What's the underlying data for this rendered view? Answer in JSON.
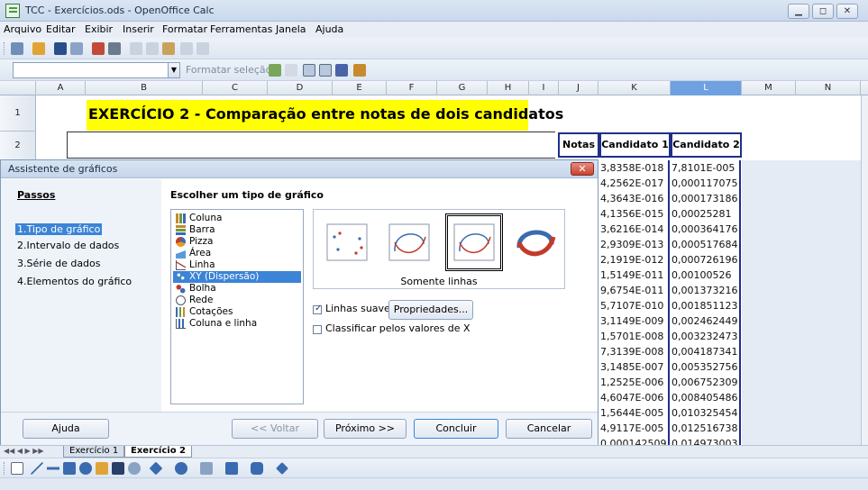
{
  "window": {
    "title": "TCC - Exercícios.ods - OpenOffice Calc",
    "controls": [
      "▁",
      "◻",
      "✕"
    ]
  },
  "menubar": [
    "Arquivo",
    "Editar",
    "Exibir",
    "Inserir",
    "Formatar",
    "Ferramentas",
    "Janela",
    "Ajuda"
  ],
  "formatbar": {
    "format_selection": "Formatar seleção"
  },
  "columns": [
    "A",
    "B",
    "C",
    "D",
    "E",
    "F",
    "G",
    "H",
    "I",
    "J",
    "K",
    "L",
    "M",
    "N"
  ],
  "rows": [
    "1",
    "2"
  ],
  "sheet": {
    "title": "EXERCÍCIO 2 - Comparação entre notas de dois candidatos",
    "headers": {
      "notas": "Notas",
      "cand1": "Candidato 1",
      "cand2": "Candidato 2"
    },
    "data": [
      [
        "3,8358E-018",
        "7,8101E-005"
      ],
      [
        "4,2562E-017",
        "0,000117075"
      ],
      [
        "4,3643E-016",
        "0,000173186"
      ],
      [
        "4,1356E-015",
        "0,00025281"
      ],
      [
        "3,6216E-014",
        "0,000364176"
      ],
      [
        "2,9309E-013",
        "0,000517684"
      ],
      [
        "2,1919E-012",
        "0,000726196"
      ],
      [
        "1,5149E-011",
        "0,00100526"
      ],
      [
        "9,6754E-011",
        "0,001373216"
      ],
      [
        "5,7107E-010",
        "0,001851123"
      ],
      [
        "3,1149E-009",
        "0,002462449"
      ],
      [
        "1,5701E-008",
        "0,003232473"
      ],
      [
        "7,3139E-008",
        "0,004187341"
      ],
      [
        "3,1485E-007",
        "0,005352756"
      ],
      [
        "1,2525E-006",
        "0,006752309"
      ],
      [
        "4,6047E-006",
        "0,008405486"
      ],
      [
        "1,5644E-005",
        "0,010325454"
      ],
      [
        "4,9117E-005",
        "0,012516738"
      ],
      [
        "0,000142509",
        "0,014973003"
      ]
    ]
  },
  "dialog": {
    "title": "Assistente de gráficos",
    "close": "✕",
    "steps_title": "Passos",
    "steps": [
      "1.Tipo de gráfico",
      "2.Intervalo de dados",
      "3.Série de dados",
      "4.Elementos do gráfico"
    ],
    "main_title": "Escolher um tipo de gráfico",
    "chart_types": [
      "Coluna",
      "Barra",
      "Pizza",
      "Área",
      "Linha",
      "XY (Dispersão)",
      "Bolha",
      "Rede",
      "Cotações",
      "Coluna e linha"
    ],
    "selected_type": "XY (Dispersão)",
    "variant_label": "Somente linhas",
    "smooth_lines": "Linhas suaves",
    "properties_btn": "Propriedades...",
    "sort_x": "Classificar pelos valores de X",
    "buttons": {
      "help": "Ajuda",
      "back": "<< Voltar",
      "next": "Próximo >>",
      "finish": "Concluir",
      "cancel": "Cancelar"
    }
  },
  "tabs": [
    "Exercício 1",
    "Exercício 2"
  ],
  "colors": {
    "selection": "#3b84d6",
    "title_fill": "#ffff00",
    "border_blue": "#1f2f8a"
  }
}
